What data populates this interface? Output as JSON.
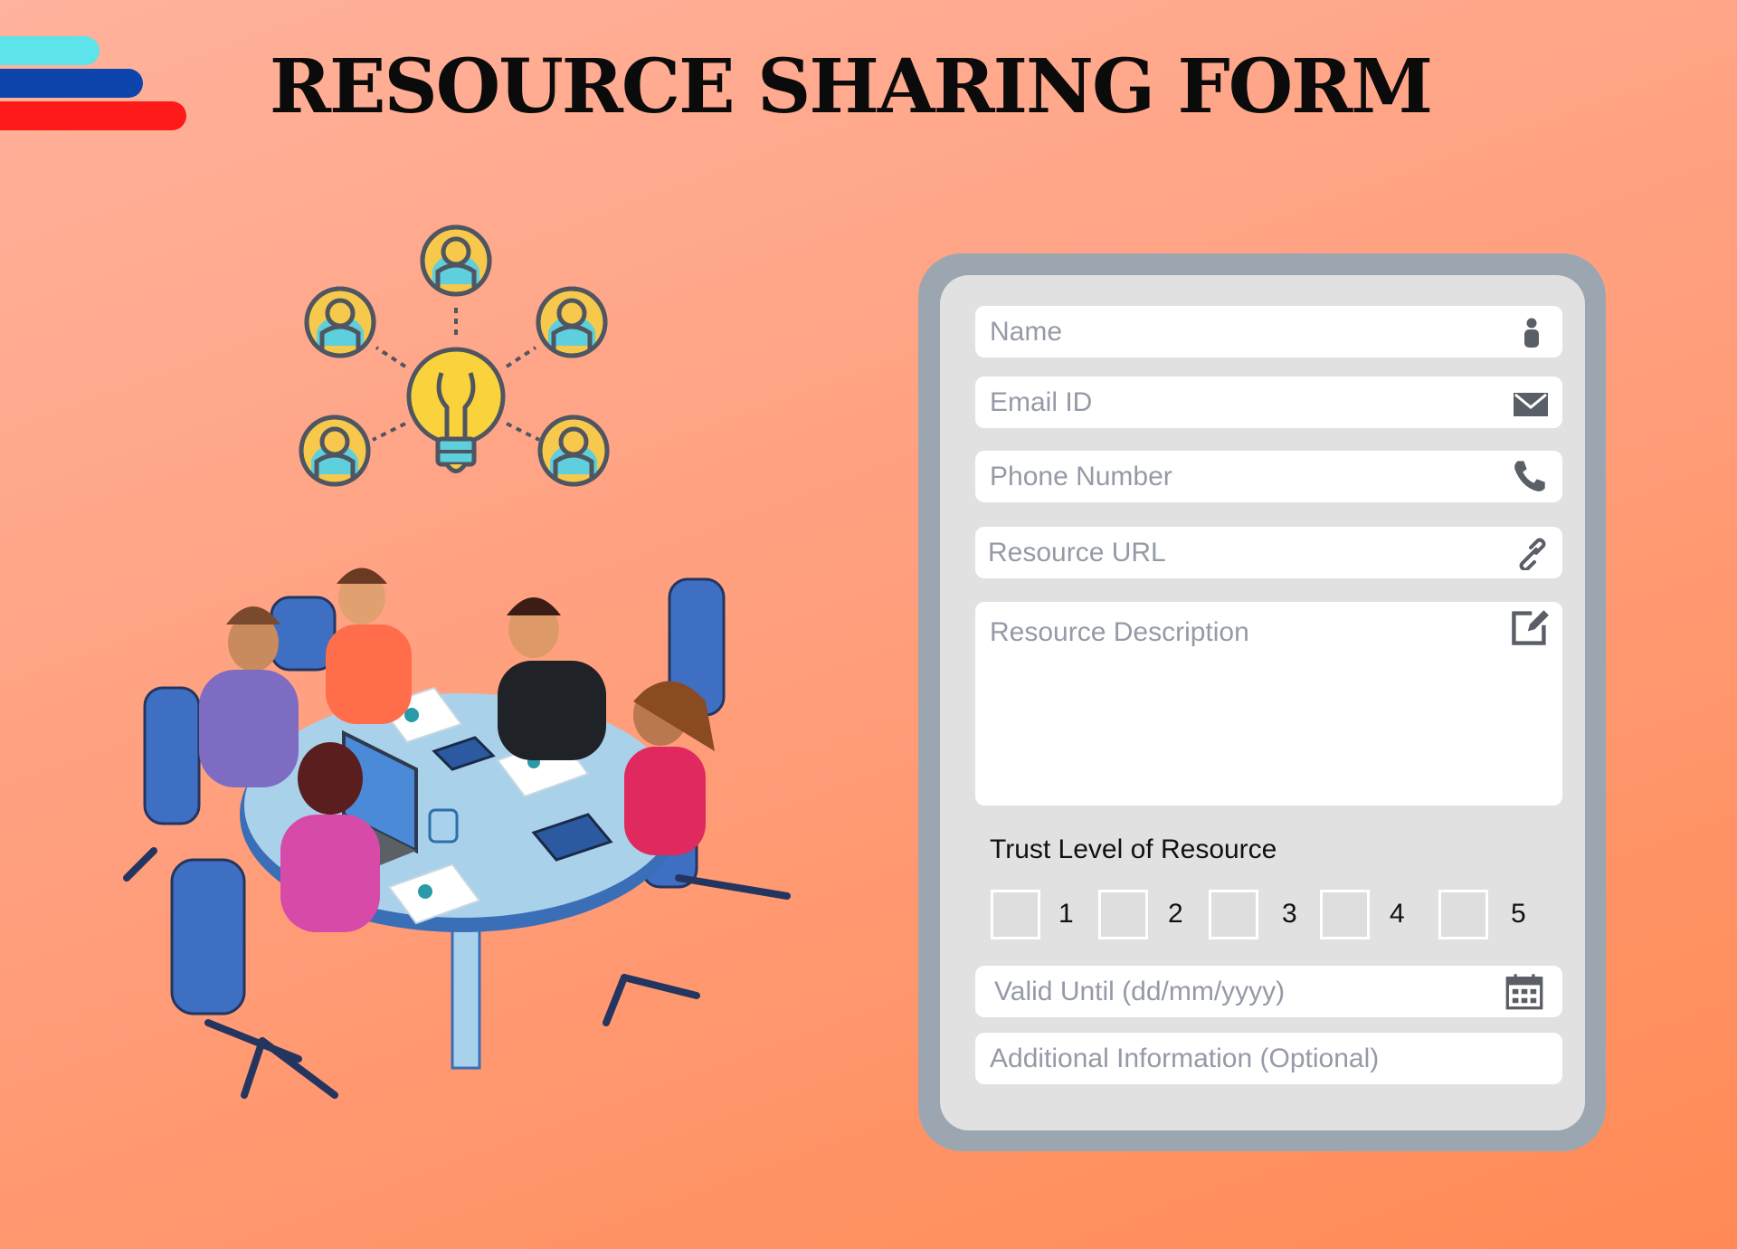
{
  "header": {
    "title": "RESOURCE SHARING FORM"
  },
  "colors": {
    "stripe_top": "#5de3ea",
    "stripe_mid": "#0d45ad",
    "stripe_bottom": "#ff1a1a",
    "form_frame": "#9ca6b1",
    "form_panel": "#e1e1e1",
    "placeholder": "#949aa6"
  },
  "form": {
    "name": {
      "placeholder": "Name",
      "icon": "person-icon"
    },
    "email": {
      "placeholder": "Email ID",
      "icon": "envelope-icon"
    },
    "phone": {
      "placeholder": "Phone Number",
      "icon": "phone-icon"
    },
    "url": {
      "placeholder": "Resource URL",
      "icon": "link-icon"
    },
    "description": {
      "placeholder": "Resource Description",
      "icon": "edit-icon"
    },
    "trust": {
      "label": "Trust Level of Resource",
      "options": [
        "1",
        "2",
        "3",
        "4",
        "5"
      ]
    },
    "valid_until": {
      "placeholder": "Valid Until (dd/mm/yyyy)",
      "icon": "calendar-icon"
    },
    "additional": {
      "placeholder": "Additional Information (Optional)"
    }
  }
}
